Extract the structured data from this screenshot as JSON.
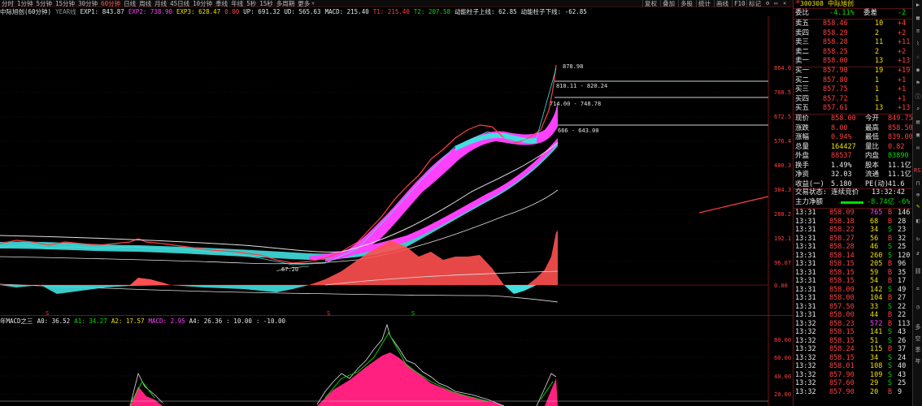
{
  "periods": [
    "分时",
    "1分钟",
    "5分钟",
    "15分钟",
    "30分钟",
    "60分钟",
    "日线",
    "周线",
    "月线",
    "45日线",
    "10分钟",
    "季线",
    "年线",
    "5秒",
    "15秒",
    "多周期",
    "更多"
  ],
  "active_period": "60分钟",
  "top_buttons": [
    "复权",
    "叠加",
    "多股",
    "统计",
    "画线",
    "F10",
    "标记"
  ],
  "win_icons": [
    "⚙",
    "▭",
    "✕"
  ],
  "ind1": {
    "name": "中际旭创(60分钟)",
    "yl": "YEAR线",
    "exp1": "EXP1: 843.87",
    "exp2": "EXP2: 738.90",
    "exp3": "EXP3: 628.47",
    "zero": "0.00",
    "up": "UP: 691.32",
    "ud": "UD: 565.63",
    "macd": "MACD: 215.40",
    "t1": "T1: 215.40",
    "t2": "T2: 207.58",
    "up2": "动能柱子上线: 62.85",
    "dn2": "动能柱子下线: -62.85"
  },
  "ind2": {
    "name": "年MACD之三",
    "a0": "A0: 36.52",
    "a1": "A1: 34.27",
    "a2": "A2: 17.57",
    "macd": "MACD: 2.95",
    "a4": "A4: 26.36",
    "z1": ": 10.00",
    "z2": ": -10.00"
  },
  "axis1": [
    "864.6",
    "768.5",
    "672.5",
    "576.4",
    "480.3",
    "384.3",
    "288.2",
    "192.1",
    "96.07",
    "0.00"
  ],
  "axis2": [
    "80.00",
    "60.00",
    "40.00",
    "20.00"
  ],
  "chart_labels": {
    "high": "878.98",
    "l1": "810.11 - 820.24",
    "l2": "714.00 - 748.78",
    "l3": "666 - 643.00",
    "low": "67.20"
  },
  "s_marks": [
    "S",
    "S",
    "S"
  ],
  "stock": {
    "code": "300308",
    "name": "中际旭创",
    "market": "深"
  },
  "weibi": {
    "label": "委比",
    "value": "-4.11%",
    "label2": "委差",
    "value2": "-2"
  },
  "asks": [
    {
      "label": "卖五",
      "price": "858.46",
      "vol": "10",
      "chg": "+4"
    },
    {
      "label": "卖四",
      "price": "858.29",
      "vol": "2",
      "chg": "+2"
    },
    {
      "label": "卖三",
      "price": "858.28",
      "vol": "11",
      "chg": "+11"
    },
    {
      "label": "卖二",
      "price": "858.25",
      "vol": "2",
      "chg": "+2"
    },
    {
      "label": "卖一",
      "price": "858.00",
      "vol": "13",
      "chg": "+13"
    }
  ],
  "bids": [
    {
      "label": "买一",
      "price": "857.90",
      "vol": "19",
      "chg": "+19"
    },
    {
      "label": "买二",
      "price": "857.80",
      "vol": "1",
      "chg": "+1"
    },
    {
      "label": "买三",
      "price": "857.75",
      "vol": "1",
      "chg": "+1"
    },
    {
      "label": "买四",
      "price": "857.72",
      "vol": "1",
      "chg": "+1"
    },
    {
      "label": "买五",
      "price": "857.61",
      "vol": "13",
      "chg": "+13"
    }
  ],
  "quotes": [
    {
      "l1": "现价",
      "v1": "858.00",
      "l2": "今开",
      "v2": "849.75"
    },
    {
      "l1": "涨跌",
      "v1": "8.00",
      "l2": "最高",
      "v2": "858.50"
    },
    {
      "l1": "涨幅",
      "v1": "0.94%",
      "l2": "最低",
      "v2": "839.00"
    },
    {
      "l1": "总量",
      "v1": "164427",
      "l2": "量比",
      "v2": "0.82"
    },
    {
      "l1": "外盘",
      "v1": "88537",
      "l2": "内盘",
      "v2": "83890"
    },
    {
      "l1": "换手",
      "v1": "1.49%",
      "l2": "股本",
      "v2": "11.1亿"
    },
    {
      "l1": "净资",
      "v1": "32.03",
      "l2": "流通",
      "v2": "11.1亿"
    },
    {
      "l1": "收益(一)",
      "v1": "5.180",
      "l2": "PE(动)",
      "v2": "41.6"
    }
  ],
  "status": {
    "label": "交易状态: 连续竞价",
    "time": "13:32:42"
  },
  "fund": {
    "label": "主力净额",
    "value": "-8.74亿",
    "pct": "-6%"
  },
  "ticks": [
    {
      "t": "13:31",
      "p": "858.09",
      "v": "765",
      "d": "B",
      "n": "146"
    },
    {
      "t": "13:31",
      "p": "858.18",
      "v": "68",
      "d": "B",
      "n": "28"
    },
    {
      "t": "13:31",
      "p": "858.22",
      "v": "34",
      "d": "S",
      "n": "23"
    },
    {
      "t": "13:31",
      "p": "858.27",
      "v": "56",
      "d": "B",
      "n": "32"
    },
    {
      "t": "13:31",
      "p": "858.28",
      "v": "46",
      "d": "S",
      "n": "25"
    },
    {
      "t": "13:31",
      "p": "858.14",
      "v": "260",
      "d": "S",
      "n": "120"
    },
    {
      "t": "13:31",
      "p": "858.15",
      "v": "205",
      "d": "B",
      "n": "96"
    },
    {
      "t": "13:31",
      "p": "858.15",
      "v": "59",
      "d": "B",
      "n": "35"
    },
    {
      "t": "13:31",
      "p": "858.15",
      "v": "54",
      "d": "B",
      "n": "17"
    },
    {
      "t": "13:31",
      "p": "858.00",
      "v": "142",
      "d": "S",
      "n": "49"
    },
    {
      "t": "13:31",
      "p": "858.00",
      "v": "104",
      "d": "B",
      "n": "27"
    },
    {
      "t": "13:31",
      "p": "857.50",
      "v": "33",
      "d": "S",
      "n": "22"
    },
    {
      "t": "13:31",
      "p": "858.00",
      "v": "44",
      "d": "B",
      "n": "22"
    },
    {
      "t": "13:32",
      "p": "858.23",
      "v": "572",
      "d": "B",
      "n": "113"
    },
    {
      "t": "13:32",
      "p": "858.15",
      "v": "141",
      "d": "S",
      "n": "43"
    },
    {
      "t": "13:32",
      "p": "858.15",
      "v": "51",
      "d": "S",
      "n": "26"
    },
    {
      "t": "13:32",
      "p": "858.24",
      "v": "115",
      "d": "B",
      "n": "37"
    },
    {
      "t": "13:32",
      "p": "858.15",
      "v": "34",
      "d": "S",
      "n": "24"
    },
    {
      "t": "13:32",
      "p": "858.01",
      "v": "108",
      "d": "S",
      "n": "40"
    },
    {
      "t": "13:32",
      "p": "857.90",
      "v": "109",
      "d": "S",
      "n": "43"
    },
    {
      "t": "13:32",
      "p": "857.60",
      "v": "29",
      "d": "S",
      "n": "25"
    },
    {
      "t": "13:32",
      "p": "857.90",
      "v": "20",
      "d": "B",
      "n": "9"
    }
  ],
  "toolbar_icons": [
    "多",
    "空",
    "季",
    "年"
  ],
  "colors": {
    "up": "#ff4040",
    "down": "#00e000",
    "magenta": "#ff40ff",
    "cyan": "#40e0e0"
  }
}
